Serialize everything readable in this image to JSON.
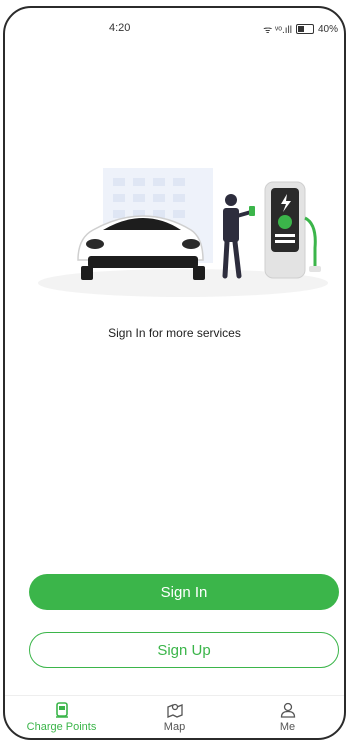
{
  "status": {
    "time": "4:20",
    "signal": "ᯤ ᵛᵒ.ıll",
    "battery": "40%"
  },
  "tagline": "Sign In for more services",
  "buttons": {
    "sign_in": "Sign In",
    "sign_up": "Sign Up"
  },
  "tabs": [
    {
      "label": "Charge Points",
      "icon": "charge-point-icon",
      "active": true
    },
    {
      "label": "Map",
      "icon": "map-icon",
      "active": false
    },
    {
      "label": "Me",
      "icon": "person-icon",
      "active": false
    }
  ],
  "colors": {
    "accent": "#3bb54a",
    "text": "#222222",
    "tab_inactive": "#555555"
  }
}
